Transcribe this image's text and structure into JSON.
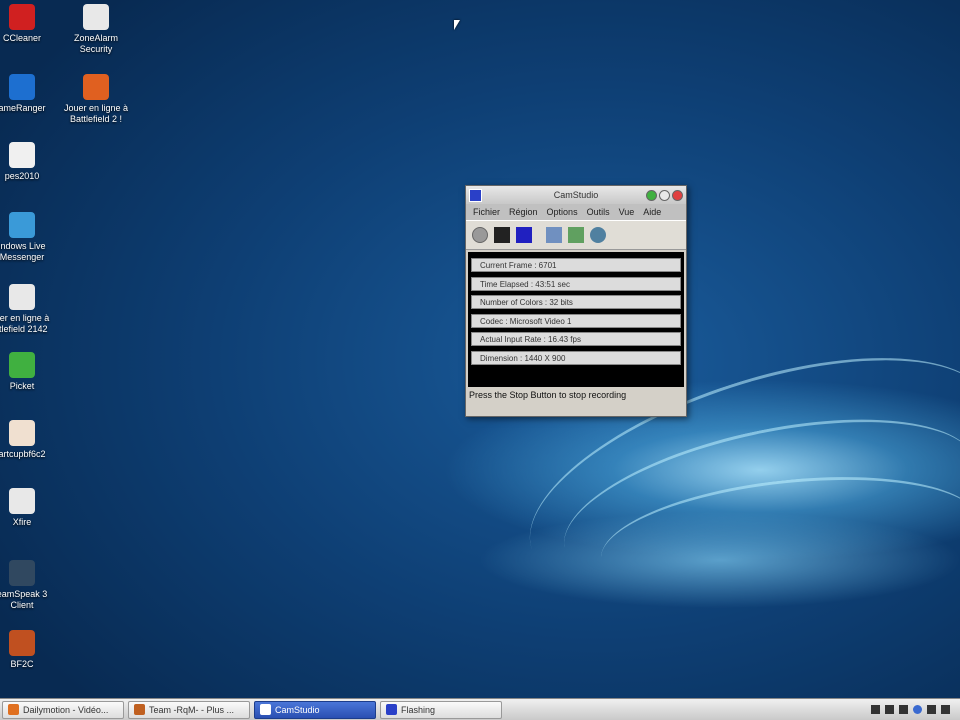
{
  "desktop": {
    "icons": [
      {
        "label": "CCleaner",
        "icon": "ccleaner-icon",
        "color": "#d02020"
      },
      {
        "label": "ZoneAlarm Security",
        "icon": "zonealarm-icon",
        "color": "#e8e8e8"
      },
      {
        "label": "ameRanger",
        "icon": "gameranger-icon",
        "color": "#1d6fd0"
      },
      {
        "label": "Jouer en ligne à Battlefield 2 !",
        "icon": "battlefield-icon",
        "color": "#e06020"
      },
      {
        "label": "pes2010",
        "icon": "pes-icon",
        "color": "#f0f0f0"
      },
      {
        "label": "indows Live Messenger",
        "icon": "messenger-icon",
        "color": "#3a9ad8"
      },
      {
        "label": "uer en ligne à ttlefield 2142",
        "icon": "battlefield2142-icon",
        "color": "#e8e8e8"
      },
      {
        "label": "Picket",
        "icon": "picket-icon",
        "color": "#40b040"
      },
      {
        "label": "artcupbf6c2",
        "icon": "artcup-icon",
        "color": "#f0e0d0"
      },
      {
        "label": "Xfire",
        "icon": "xfire-icon",
        "color": "#e8e8e8"
      },
      {
        "label": "eamSpeak 3 Client",
        "icon": "teamspeak-icon",
        "color": "#304860"
      },
      {
        "label": "BF2C",
        "icon": "bf2c-icon",
        "color": "#c05020"
      }
    ]
  },
  "camstudio": {
    "title": "CamStudio",
    "menu": [
      "Fichier",
      "Région",
      "Options",
      "Outils",
      "Vue",
      "Aide"
    ],
    "toolbar": [
      "record-icon",
      "pause-icon",
      "stop-icon",
      "region-icon",
      "annotate-icon",
      "options-icon"
    ],
    "fields": {
      "current_frame": "Current Frame : 6701",
      "time_elapsed": "Time Elapsed : 43:51 sec",
      "colors": "Number of Colors : 32 bits",
      "codec": "Codec : Microsoft Video 1",
      "input_rate": "Actual Input Rate : 16.43 fps",
      "dimension": "Dimension : 1440 X 900"
    },
    "status": "Press the Stop Button to stop recording"
  },
  "taskbar": {
    "tasks": [
      {
        "label": "Dailymotion - Vidéo...",
        "icon": "firefox-icon",
        "active": false
      },
      {
        "label": "Team -RqM- - Plus ...",
        "icon": "browser-icon",
        "active": false
      },
      {
        "label": "CamStudio",
        "icon": "camstudio-icon",
        "active": true
      },
      {
        "label": "Flashing",
        "icon": "flashing-icon",
        "active": false
      }
    ]
  },
  "colors": {
    "accent": "#2a4fb2",
    "desktop": "#0e3f74"
  }
}
